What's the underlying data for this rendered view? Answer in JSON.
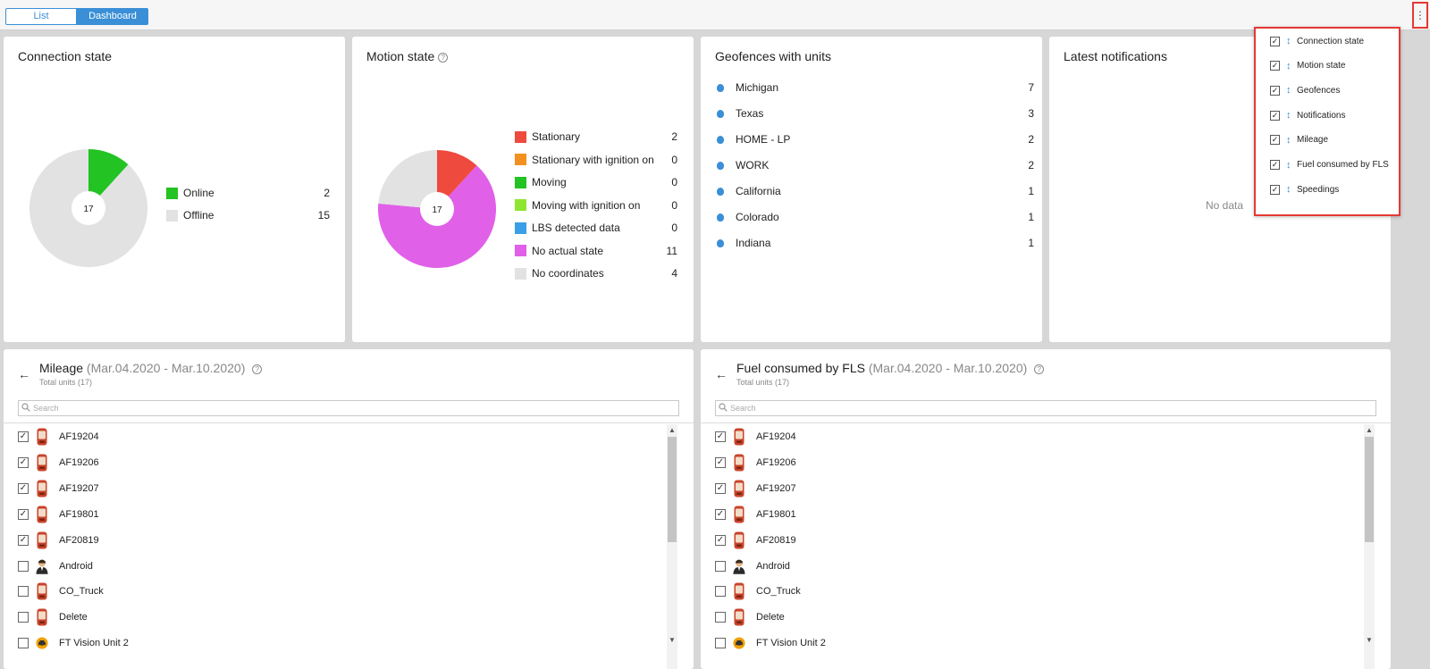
{
  "tabs": {
    "list": "List",
    "dashboard": "Dashboard"
  },
  "menu_glyph": "⋮",
  "connection": {
    "title": "Connection state",
    "center": "17",
    "items": [
      {
        "label": "Online",
        "value": "2",
        "color": "#22c322"
      },
      {
        "label": "Offline",
        "value": "15",
        "color": "#e2e2e2"
      }
    ]
  },
  "motion": {
    "title": "Motion state",
    "help": "?",
    "center": "17",
    "items": [
      {
        "label": "Stationary",
        "value": "2",
        "color": "#ee4a3d"
      },
      {
        "label": "Stationary with ignition on",
        "value": "0",
        "color": "#f3901f"
      },
      {
        "label": "Moving",
        "value": "0",
        "color": "#22c322"
      },
      {
        "label": "Moving with ignition on",
        "value": "0",
        "color": "#8ee630"
      },
      {
        "label": "LBS detected data",
        "value": "0",
        "color": "#3a9fe6"
      },
      {
        "label": "No actual state",
        "value": "11",
        "color": "#e060e8"
      },
      {
        "label": "No coordinates",
        "value": "4",
        "color": "#e2e2e2"
      }
    ]
  },
  "geofences": {
    "title": "Geofences with units",
    "items": [
      {
        "label": "Michigan",
        "value": "7"
      },
      {
        "label": "Texas",
        "value": "3"
      },
      {
        "label": "HOME - LP",
        "value": "2"
      },
      {
        "label": "WORK",
        "value": "2"
      },
      {
        "label": "California",
        "value": "1"
      },
      {
        "label": "Colorado",
        "value": "1"
      },
      {
        "label": "Indiana",
        "value": "1"
      }
    ]
  },
  "notifications": {
    "title": "Latest notifications",
    "empty": "No data"
  },
  "settings_menu": {
    "items": [
      {
        "label": "Connection state",
        "checked": true
      },
      {
        "label": "Motion state",
        "checked": true
      },
      {
        "label": "Geofences",
        "checked": true
      },
      {
        "label": "Notifications",
        "checked": true
      },
      {
        "label": "Mileage",
        "checked": true
      },
      {
        "label": "Fuel consumed by FLS",
        "checked": true
      },
      {
        "label": "Speedings",
        "checked": true
      }
    ]
  },
  "mileage": {
    "back": "←",
    "title": "Mileage",
    "dates": "(Mar.04.2020 - Mar.10.2020)",
    "help": "?",
    "subtitle": "Total units (17)",
    "search_placeholder": "Search"
  },
  "fuel": {
    "back": "←",
    "title": "Fuel consumed by FLS",
    "dates": "(Mar.04.2020 - Mar.10.2020)",
    "help": "?",
    "subtitle": "Total units (17)",
    "search_placeholder": "Search"
  },
  "units": [
    {
      "name": "AF19204",
      "checked": true,
      "icon": "phone-icon"
    },
    {
      "name": "AF19206",
      "checked": true,
      "icon": "phone-icon"
    },
    {
      "name": "AF19207",
      "checked": true,
      "icon": "phone-icon"
    },
    {
      "name": "AF19801",
      "checked": true,
      "icon": "phone-icon"
    },
    {
      "name": "AF20819",
      "checked": true,
      "icon": "phone-icon"
    },
    {
      "name": "Android",
      "checked": false,
      "icon": "person-icon"
    },
    {
      "name": "CO_Truck",
      "checked": false,
      "icon": "phone-icon"
    },
    {
      "name": "Delete",
      "checked": false,
      "icon": "phone-icon"
    },
    {
      "name": "FT Vision Unit  2",
      "checked": false,
      "icon": "car-icon"
    }
  ]
}
